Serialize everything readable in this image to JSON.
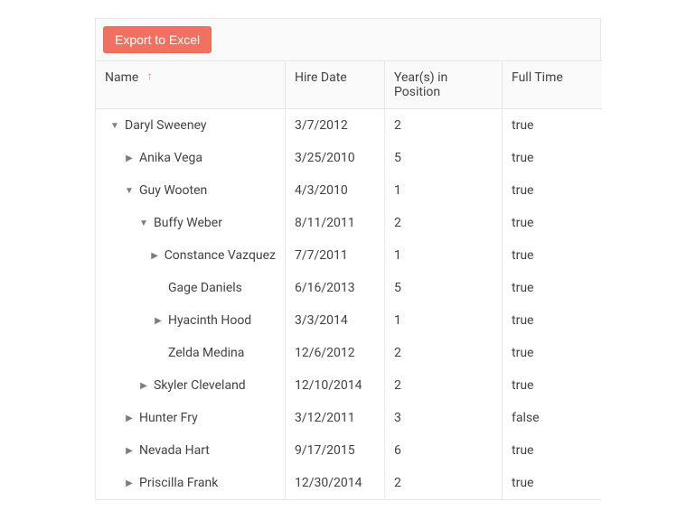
{
  "toolbar": {
    "export_label": "Export to Excel"
  },
  "columns": [
    {
      "title": "Name",
      "sorted_asc": true
    },
    {
      "title": "Hire Date"
    },
    {
      "title": "Year(s) in Position"
    },
    {
      "title": "Full Time"
    }
  ],
  "glyphs": {
    "expanded": "▼",
    "collapsed": "▶",
    "sort_asc": "↑"
  },
  "rows": [
    {
      "level": 0,
      "state": "expanded",
      "name": "Daryl Sweeney",
      "hire": "3/7/2012",
      "years": "2",
      "ft": "true"
    },
    {
      "level": 1,
      "state": "collapsed",
      "name": "Anika Vega",
      "hire": "3/25/2010",
      "years": "5",
      "ft": "true"
    },
    {
      "level": 1,
      "state": "expanded",
      "name": "Guy Wooten",
      "hire": "4/3/2010",
      "years": "1",
      "ft": "true"
    },
    {
      "level": 2,
      "state": "expanded",
      "name": "Buffy Weber",
      "hire": "8/11/2011",
      "years": "2",
      "ft": "true"
    },
    {
      "level": 3,
      "state": "collapsed",
      "name": "Constance Vazquez",
      "hire": "7/7/2011",
      "years": "1",
      "ft": "true"
    },
    {
      "level": 3,
      "state": "leaf",
      "name": "Gage Daniels",
      "hire": "6/16/2013",
      "years": "5",
      "ft": "true"
    },
    {
      "level": 3,
      "state": "collapsed",
      "name": "Hyacinth Hood",
      "hire": "3/3/2014",
      "years": "1",
      "ft": "true"
    },
    {
      "level": 3,
      "state": "leaf",
      "name": "Zelda Medina",
      "hire": "12/6/2012",
      "years": "2",
      "ft": "true"
    },
    {
      "level": 2,
      "state": "collapsed",
      "name": "Skyler Cleveland",
      "hire": "12/10/2014",
      "years": "2",
      "ft": "true"
    },
    {
      "level": 1,
      "state": "collapsed",
      "name": "Hunter Fry",
      "hire": "3/12/2011",
      "years": "3",
      "ft": "false"
    },
    {
      "level": 1,
      "state": "collapsed",
      "name": "Nevada Hart",
      "hire": "9/17/2015",
      "years": "6",
      "ft": "true"
    },
    {
      "level": 1,
      "state": "collapsed",
      "name": "Priscilla Frank",
      "hire": "12/30/2014",
      "years": "2",
      "ft": "true"
    }
  ]
}
